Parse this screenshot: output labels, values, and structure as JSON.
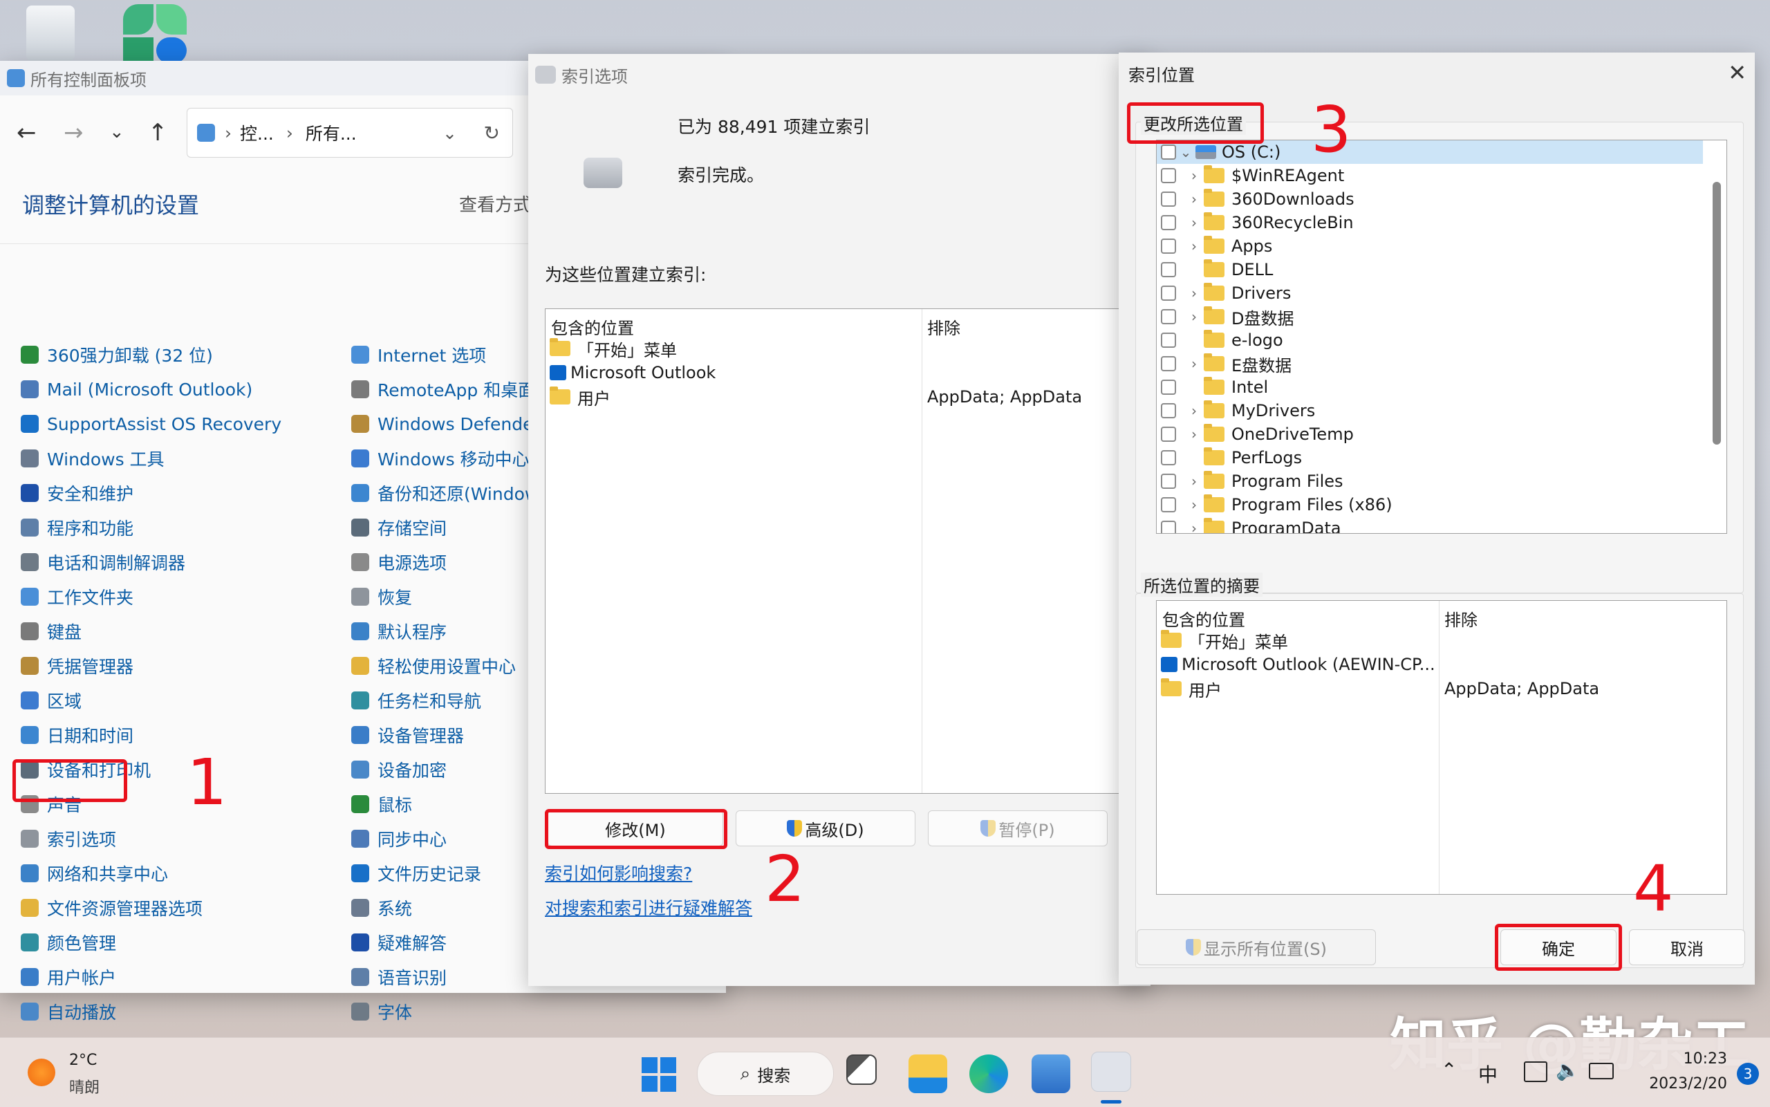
{
  "desktop": {
    "watermark": "知乎 @勤杂工"
  },
  "control_panel": {
    "title": "所有控制面板项",
    "crumbs": [
      "控...",
      "所有..."
    ],
    "heading": "调整计算机的设置",
    "view_by": "查看方式",
    "col1": [
      "360强力卸载 (32 位)",
      "Mail (Microsoft Outlook)",
      "SupportAssist OS Recovery",
      "Windows 工具",
      "安全和维护",
      "程序和功能",
      "电话和调制解调器",
      "工作文件夹",
      "键盘",
      "凭据管理器",
      "区域",
      "日期和时间",
      "设备和打印机",
      "声音",
      "索引选项",
      "网络和共享中心",
      "文件资源管理器选项",
      "颜色管理",
      "用户帐户",
      "自动播放"
    ],
    "col2": [
      "Internet 选项",
      "RemoteApp 和桌面",
      "Windows Defende",
      "Windows 移动中心",
      "备份和还原(Window",
      "存储空间",
      "电源选项",
      "恢复",
      "默认程序",
      "轻松使用设置中心",
      "任务栏和导航",
      "设备管理器",
      "设备加密",
      "鼠标",
      "同步中心",
      "文件历史记录",
      "系统",
      "疑难解答",
      "语音识别",
      "字体"
    ]
  },
  "index_options": {
    "title": "索引选项",
    "count_text": "已为 88,491 项建立索引",
    "status_text": "索引完成。",
    "locations_label": "为这些位置建立索引:",
    "col_included": "包含的位置",
    "col_excluded": "排除",
    "rows": [
      {
        "name": "「开始」菜单",
        "exclude": ""
      },
      {
        "name": "Microsoft Outlook",
        "exclude": ""
      },
      {
        "name": "用户",
        "exclude": "AppData; AppData"
      }
    ],
    "btn_modify": "修改(M)",
    "btn_advanced": "高级(D)",
    "btn_pause": "暂停(P)",
    "link1": "索引如何影响搜索?",
    "link2": "对搜索和索引进行疑难解答"
  },
  "index_locations": {
    "title": "索引位置",
    "change_label": "更改所选位置",
    "tree": [
      {
        "name": "OS (C:)",
        "expand": "v",
        "drive": true
      },
      {
        "name": "$WinREAgent",
        "expand": ">"
      },
      {
        "name": "360Downloads",
        "expand": ">"
      },
      {
        "name": "360RecycleBin",
        "expand": ">"
      },
      {
        "name": "Apps",
        "expand": ">"
      },
      {
        "name": "DELL",
        "expand": ""
      },
      {
        "name": "Drivers",
        "expand": ">"
      },
      {
        "name": "D盘数据",
        "expand": ">"
      },
      {
        "name": "e-logo",
        "expand": ""
      },
      {
        "name": "E盘数据",
        "expand": ">"
      },
      {
        "name": "Intel",
        "expand": ""
      },
      {
        "name": "MyDrivers",
        "expand": ">"
      },
      {
        "name": "OneDriveTemp",
        "expand": ">"
      },
      {
        "name": "PerfLogs",
        "expand": ""
      },
      {
        "name": "Program Files",
        "expand": ">"
      },
      {
        "name": "Program Files (x86)",
        "expand": ">"
      },
      {
        "name": "ProgramData",
        "expand": ">"
      }
    ],
    "summary_label": "所选位置的摘要",
    "col_included": "包含的位置",
    "col_excluded": "排除",
    "summary_rows": [
      {
        "name": "「开始」菜单",
        "exclude": ""
      },
      {
        "name": "Microsoft Outlook (AEWIN-CP...",
        "exclude": ""
      },
      {
        "name": "用户",
        "exclude": "AppData; AppData"
      }
    ],
    "btn_show_all": "显示所有位置(S)",
    "btn_ok": "确定",
    "btn_cancel": "取消"
  },
  "annotations": [
    "1",
    "2",
    "3",
    "4"
  ],
  "taskbar": {
    "temp": "2°C",
    "weather": "晴朗",
    "search": "搜索",
    "ime": "中",
    "time": "10:23",
    "date": "2023/2/20",
    "badge": "3"
  },
  "colors": {
    "annotation_red": "#e8111c",
    "link_blue": "#1060c0",
    "accent": "#0a64c8"
  }
}
